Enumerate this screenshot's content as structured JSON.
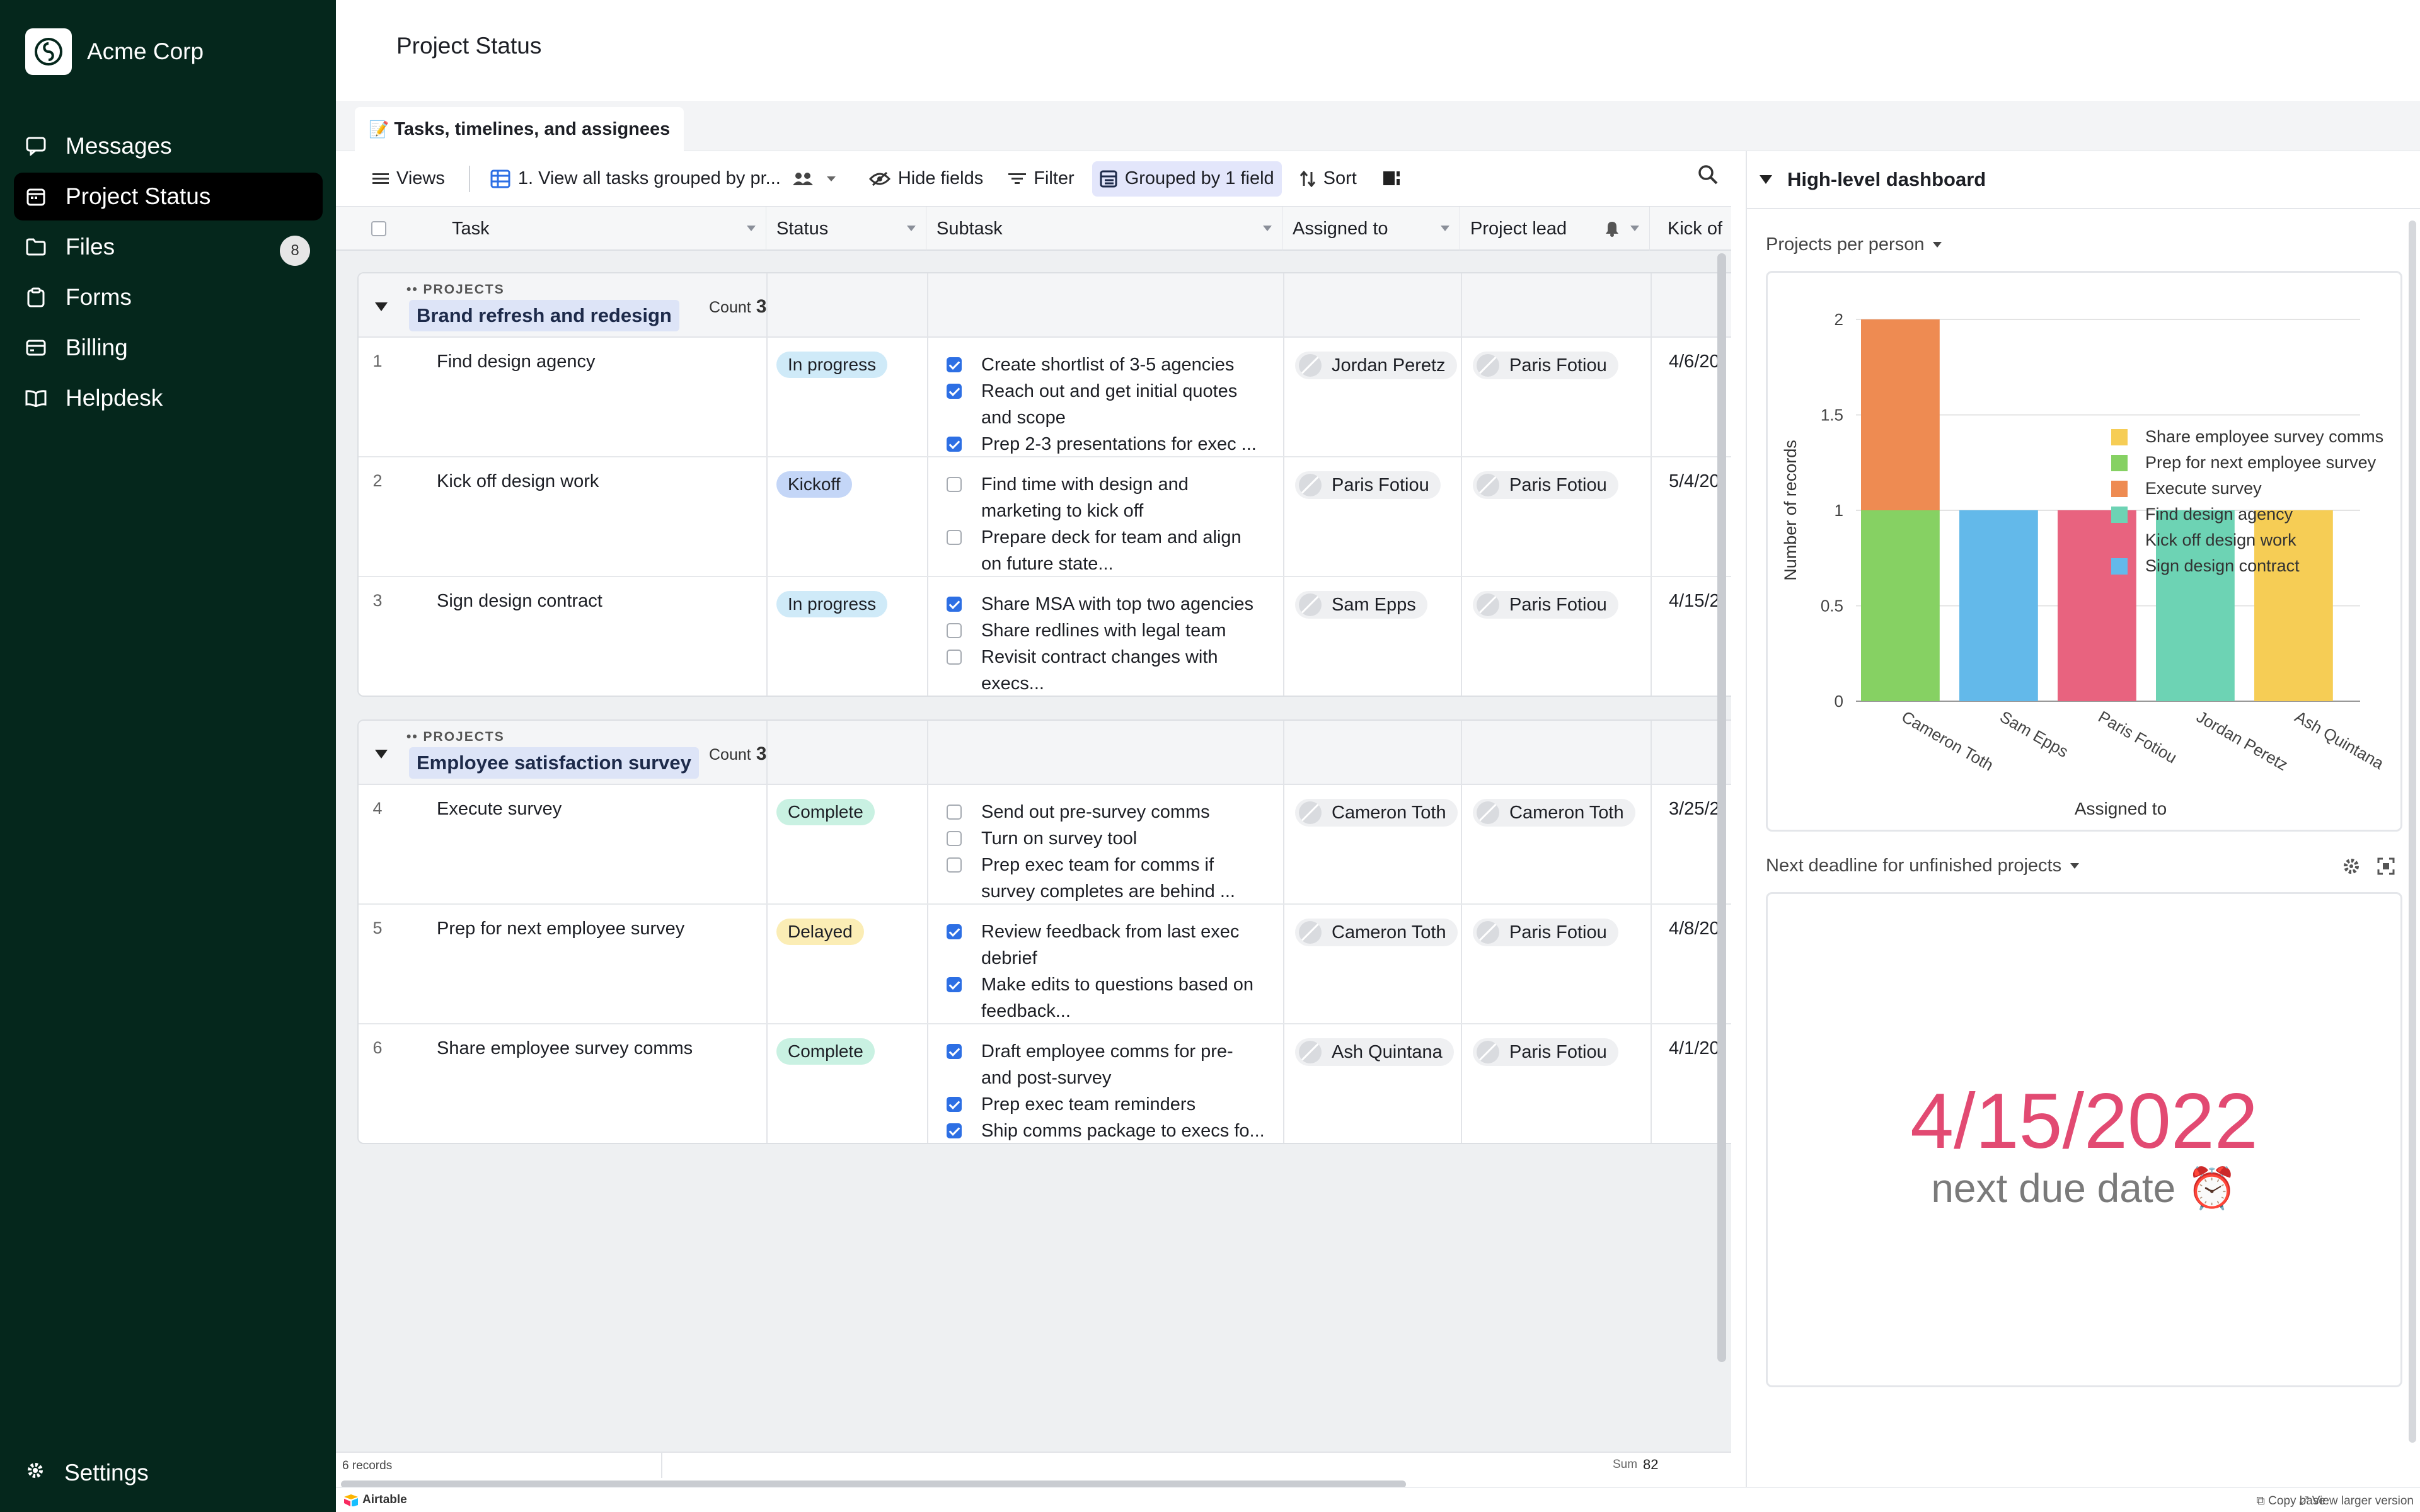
{
  "sidebar": {
    "org_name": "Acme Corp",
    "items": [
      {
        "label": "Messages",
        "icon": "messages-icon",
        "active": false
      },
      {
        "label": "Project Status",
        "icon": "calendar-icon",
        "active": true
      },
      {
        "label": "Files",
        "icon": "folder-icon",
        "active": false,
        "badge": "8"
      },
      {
        "label": "Forms",
        "icon": "clipboard-icon",
        "active": false
      },
      {
        "label": "Billing",
        "icon": "card-icon",
        "active": false
      },
      {
        "label": "Helpdesk",
        "icon": "book-icon",
        "active": false
      }
    ],
    "settings_label": "Settings"
  },
  "header": {
    "title": "Project Status",
    "tab_label": "Tasks, timelines, and assignees",
    "tab_emoji": "📝"
  },
  "toolbar": {
    "views_label": "Views",
    "view_name": "1. View all tasks grouped by pr...",
    "hide_fields_label": "Hide fields",
    "filter_label": "Filter",
    "grouped_label": "Grouped by 1 field",
    "sort_label": "Sort"
  },
  "grid": {
    "columns": [
      "Task",
      "Status",
      "Subtask",
      "Assigned to",
      "Project lead",
      "Kick of"
    ],
    "group_field_label": "•• PROJECTS",
    "count_label": "Count",
    "groups": [
      {
        "name": "Brand refresh and redesign",
        "count": "3",
        "rows": [
          {
            "num": "1",
            "task": "Find design agency",
            "status": "In progress",
            "status_color": "#cfeaf8",
            "subtasks": [
              {
                "text": "Create shortlist of 3-5 agencies",
                "done": true
              },
              {
                "text": "Reach out and get initial quotes",
                "done": true
              },
              {
                "text": "and scope",
                "done": null
              },
              {
                "text": "Prep 2-3 presentations for exec ...",
                "done": true
              }
            ],
            "assigned": "Jordan Peretz",
            "lead": "Paris Fotiou",
            "kickoff": "4/6/20"
          },
          {
            "num": "2",
            "task": "Kick off design work",
            "status": "Kickoff",
            "status_color": "#c4d6f7",
            "subtasks": [
              {
                "text": "Find time with design and",
                "done": false
              },
              {
                "text": "marketing to kick off",
                "done": null
              },
              {
                "text": "Prepare deck for team and align",
                "done": false
              },
              {
                "text": "on future state...",
                "done": null
              }
            ],
            "assigned": "Paris Fotiou",
            "lead": "Paris Fotiou",
            "kickoff": "5/4/20"
          },
          {
            "num": "3",
            "task": "Sign design contract",
            "status": "In progress",
            "status_color": "#cfeaf8",
            "subtasks": [
              {
                "text": "Share MSA with top two agencies",
                "done": true
              },
              {
                "text": "Share redlines with legal team",
                "done": false
              },
              {
                "text": "Revisit contract changes with",
                "done": false
              },
              {
                "text": "execs...",
                "done": null
              }
            ],
            "assigned": "Sam Epps",
            "lead": "Paris Fotiou",
            "kickoff": "4/15/2"
          }
        ]
      },
      {
        "name": "Employee satisfaction survey",
        "count": "3",
        "rows": [
          {
            "num": "4",
            "task": "Execute survey",
            "status": "Complete",
            "status_color": "#c9f1e2",
            "subtasks": [
              {
                "text": "Send out pre-survey comms",
                "done": false
              },
              {
                "text": "Turn on survey tool",
                "done": false
              },
              {
                "text": "Prep exec team for comms if",
                "done": false
              },
              {
                "text": "survey completes are behind ...",
                "done": null
              }
            ],
            "assigned": "Cameron Toth",
            "lead": "Cameron Toth",
            "kickoff": "3/25/2"
          },
          {
            "num": "5",
            "task": "Prep for next employee survey",
            "status": "Delayed",
            "status_color": "#fbedb5",
            "subtasks": [
              {
                "text": "Review feedback from last exec",
                "done": true
              },
              {
                "text": "debrief",
                "done": null
              },
              {
                "text": "Make edits to questions based on",
                "done": true
              },
              {
                "text": "feedback...",
                "done": null
              }
            ],
            "assigned": "Cameron Toth",
            "lead": "Paris Fotiou",
            "kickoff": "4/8/20"
          },
          {
            "num": "6",
            "task": "Share employee survey comms",
            "status": "Complete",
            "status_color": "#c9f1e2",
            "subtasks": [
              {
                "text": "Draft employee comms for pre-",
                "done": true
              },
              {
                "text": "and post-survey",
                "done": null
              },
              {
                "text": "Prep exec team reminders",
                "done": true
              },
              {
                "text": "Ship comms package to execs fo...",
                "done": true
              }
            ],
            "assigned": "Ash Quintana",
            "lead": "Paris Fotiou",
            "kickoff": "4/1/20"
          }
        ]
      }
    ],
    "record_count": "6 records",
    "sum_label": "Sum",
    "sum_value": "82"
  },
  "bottom": {
    "brand": "Airtable",
    "copy_base": "Copy base",
    "view_larger": "View larger version"
  },
  "dashboard": {
    "title": "High-level dashboard",
    "chart_title": "Projects per person",
    "deadline_title": "Next deadline for unfinished projects",
    "big_date": "4/15/2022",
    "next_due": "next due date ⏰"
  },
  "chart_data": {
    "type": "bar",
    "stacked": true,
    "categories": [
      "Cameron Toth",
      "Sam Epps",
      "Paris Fotiou",
      "Jordan Peretz",
      "Ash Quintana"
    ],
    "series": [
      {
        "name": "Share employee survey comms",
        "color": "#f6cd55",
        "values": [
          0,
          0,
          0,
          0,
          1
        ]
      },
      {
        "name": "Prep for next employee survey",
        "color": "#86d163",
        "values": [
          1,
          0,
          0,
          0,
          0
        ]
      },
      {
        "name": "Execute survey",
        "color": "#ee8b52",
        "values": [
          1,
          0,
          0,
          0,
          0
        ]
      },
      {
        "name": "Find design agency",
        "color": "#6dd3b4",
        "values": [
          0,
          0,
          0,
          1,
          0
        ]
      },
      {
        "name": "Kick off design work",
        "color": "#e8637f",
        "values": [
          0,
          0,
          1,
          0,
          0
        ]
      },
      {
        "name": "Sign design contract",
        "color": "#63b9ea",
        "values": [
          0,
          1,
          0,
          0,
          0
        ]
      }
    ],
    "xlabel": "Assigned to",
    "ylabel": "Number of records",
    "ylim": [
      0,
      2
    ],
    "yticks": [
      "0",
      "0.5",
      "1",
      "1.5",
      "2"
    ],
    "grid": true,
    "legend": "right"
  }
}
